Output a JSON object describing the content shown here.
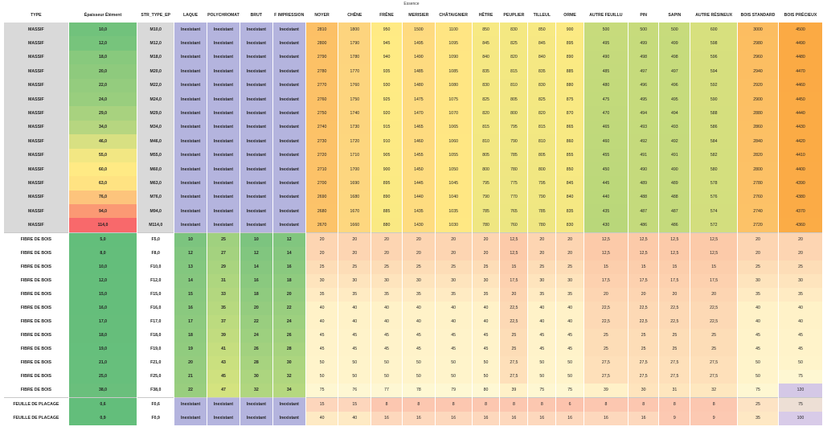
{
  "title": "Essence",
  "colors": {
    "type_massif": "#d9d9d9",
    "options_inexistant": "#b4b4de",
    "low": "#63be7b",
    "high": "#f8696b",
    "scale_low": "#ffeb84",
    "scale_high": "#f8a94a"
  },
  "headers": [
    "TYPE",
    "Épaisseur Élément",
    "STR_TYPE_EP",
    "LAQUE",
    "POLYCHROMAT",
    "BRUT",
    "F IMPRESSION",
    "NOYER",
    "CHÊNE",
    "FRÊNE",
    "MERISIER",
    "CHÂTAIGNIER",
    "HÊTRE",
    "PEUPLIER",
    "TILLEUL",
    "ORME",
    "AUTRE FEUILLU",
    "PIN",
    "SAPIN",
    "AUTRE RÉSINEUX",
    "BOIS STANDARD",
    "BOIS PRÉCIEUX"
  ],
  "rows": [
    {
      "group": "massif",
      "cells": [
        "MASSIF",
        "10,0",
        "M10,0",
        "Inexistant",
        "Inexistant",
        "Inexistant",
        "Inexistant",
        "2810",
        "1800",
        "950",
        "1500",
        "1100",
        "850",
        "830",
        "850",
        "900",
        "500",
        "500",
        "500",
        "600",
        "3000",
        "4500"
      ]
    },
    {
      "group": "massif",
      "cells": [
        "MASSIF",
        "12,0",
        "M12,0",
        "Inexistant",
        "Inexistant",
        "Inexistant",
        "Inexistant",
        "2800",
        "1790",
        "945",
        "1495",
        "1095",
        "845",
        "825",
        "845",
        "895",
        "495",
        "499",
        "499",
        "598",
        "2980",
        "4490"
      ]
    },
    {
      "group": "massif",
      "cells": [
        "MASSIF",
        "18,0",
        "M18,0",
        "Inexistant",
        "Inexistant",
        "Inexistant",
        "Inexistant",
        "2790",
        "1780",
        "940",
        "1490",
        "1090",
        "840",
        "820",
        "840",
        "890",
        "490",
        "498",
        "498",
        "596",
        "2960",
        "4480"
      ]
    },
    {
      "group": "massif",
      "cells": [
        "MASSIF",
        "20,0",
        "M20,0",
        "Inexistant",
        "Inexistant",
        "Inexistant",
        "Inexistant",
        "2780",
        "1770",
        "935",
        "1485",
        "1085",
        "835",
        "815",
        "835",
        "885",
        "485",
        "497",
        "497",
        "594",
        "2940",
        "4470"
      ]
    },
    {
      "group": "massif",
      "cells": [
        "MASSIF",
        "22,0",
        "M22,0",
        "Inexistant",
        "Inexistant",
        "Inexistant",
        "Inexistant",
        "2770",
        "1760",
        "930",
        "1480",
        "1080",
        "830",
        "810",
        "830",
        "880",
        "480",
        "496",
        "496",
        "592",
        "2920",
        "4460"
      ]
    },
    {
      "group": "massif",
      "cells": [
        "MASSIF",
        "24,0",
        "M24,0",
        "Inexistant",
        "Inexistant",
        "Inexistant",
        "Inexistant",
        "2760",
        "1750",
        "925",
        "1475",
        "1075",
        "825",
        "805",
        "825",
        "875",
        "475",
        "495",
        "495",
        "590",
        "2900",
        "4450"
      ]
    },
    {
      "group": "massif",
      "cells": [
        "MASSIF",
        "29,0",
        "M29,0",
        "Inexistant",
        "Inexistant",
        "Inexistant",
        "Inexistant",
        "2750",
        "1740",
        "920",
        "1470",
        "1070",
        "820",
        "800",
        "820",
        "870",
        "470",
        "494",
        "494",
        "588",
        "2880",
        "4440"
      ]
    },
    {
      "group": "massif",
      "cells": [
        "MASSIF",
        "34,0",
        "M34,0",
        "Inexistant",
        "Inexistant",
        "Inexistant",
        "Inexistant",
        "2740",
        "1730",
        "915",
        "1465",
        "1065",
        "815",
        "795",
        "815",
        "865",
        "465",
        "493",
        "493",
        "586",
        "2860",
        "4430"
      ]
    },
    {
      "group": "massif",
      "cells": [
        "MASSIF",
        "46,0",
        "M46,0",
        "Inexistant",
        "Inexistant",
        "Inexistant",
        "Inexistant",
        "2730",
        "1720",
        "910",
        "1460",
        "1060",
        "810",
        "790",
        "810",
        "860",
        "460",
        "492",
        "492",
        "584",
        "2840",
        "4420"
      ]
    },
    {
      "group": "massif",
      "cells": [
        "MASSIF",
        "55,0",
        "M55,0",
        "Inexistant",
        "Inexistant",
        "Inexistant",
        "Inexistant",
        "2720",
        "1710",
        "905",
        "1455",
        "1055",
        "805",
        "785",
        "805",
        "855",
        "455",
        "491",
        "491",
        "582",
        "2820",
        "4410"
      ]
    },
    {
      "group": "massif",
      "cells": [
        "MASSIF",
        "60,0",
        "M60,0",
        "Inexistant",
        "Inexistant",
        "Inexistant",
        "Inexistant",
        "2710",
        "1700",
        "900",
        "1450",
        "1050",
        "800",
        "780",
        "800",
        "850",
        "450",
        "490",
        "490",
        "580",
        "2800",
        "4400"
      ]
    },
    {
      "group": "massif",
      "cells": [
        "MASSIF",
        "63,0",
        "M63,0",
        "Inexistant",
        "Inexistant",
        "Inexistant",
        "Inexistant",
        "2700",
        "1690",
        "895",
        "1445",
        "1045",
        "795",
        "775",
        "795",
        "845",
        "445",
        "489",
        "489",
        "578",
        "2780",
        "4390"
      ]
    },
    {
      "group": "massif",
      "cells": [
        "MASSIF",
        "76,0",
        "M76,0",
        "Inexistant",
        "Inexistant",
        "Inexistant",
        "Inexistant",
        "2690",
        "1680",
        "890",
        "1440",
        "1040",
        "790",
        "770",
        "790",
        "840",
        "440",
        "488",
        "488",
        "576",
        "2760",
        "4380"
      ]
    },
    {
      "group": "massif",
      "cells": [
        "MASSIF",
        "94,0",
        "M94,0",
        "Inexistant",
        "Inexistant",
        "Inexistant",
        "Inexistant",
        "2680",
        "1670",
        "885",
        "1435",
        "1035",
        "785",
        "765",
        "785",
        "835",
        "435",
        "487",
        "487",
        "574",
        "2740",
        "4370"
      ]
    },
    {
      "group": "massif",
      "cells": [
        "MASSIF",
        "114,0",
        "M114,0",
        "Inexistant",
        "Inexistant",
        "Inexistant",
        "Inexistant",
        "2670",
        "1660",
        "880",
        "1430",
        "1030",
        "780",
        "760",
        "780",
        "830",
        "430",
        "486",
        "486",
        "572",
        "2720",
        "4360"
      ]
    },
    {
      "group": "fibre",
      "cells": [
        "FIBRE DE BOIS",
        "5,0",
        "F5,0",
        "10",
        "25",
        "10",
        "12",
        "20",
        "20",
        "20",
        "20",
        "20",
        "20",
        "12,5",
        "20",
        "20",
        "12,5",
        "12,5",
        "12,5",
        "12,5",
        "20",
        "20"
      ]
    },
    {
      "group": "fibre",
      "cells": [
        "FIBRE DE BOIS",
        "8,0",
        "F8,0",
        "12",
        "27",
        "12",
        "14",
        "20",
        "20",
        "20",
        "20",
        "20",
        "20",
        "12,5",
        "20",
        "20",
        "12,5",
        "12,5",
        "12,5",
        "12,5",
        "20",
        "20"
      ]
    },
    {
      "group": "fibre",
      "cells": [
        "FIBRE DE BOIS",
        "10,0",
        "F10,0",
        "13",
        "29",
        "14",
        "16",
        "25",
        "25",
        "25",
        "25",
        "25",
        "25",
        "15",
        "25",
        "25",
        "15",
        "15",
        "15",
        "15",
        "25",
        "25"
      ]
    },
    {
      "group": "fibre",
      "cells": [
        "FIBRE DE BOIS",
        "12,0",
        "F12,0",
        "14",
        "31",
        "16",
        "18",
        "30",
        "30",
        "30",
        "30",
        "30",
        "30",
        "17,5",
        "30",
        "30",
        "17,5",
        "17,5",
        "17,5",
        "17,5",
        "30",
        "30"
      ]
    },
    {
      "group": "fibre",
      "cells": [
        "FIBRE DE BOIS",
        "15,0",
        "F15,0",
        "15",
        "33",
        "18",
        "20",
        "35",
        "35",
        "35",
        "35",
        "35",
        "35",
        "20",
        "35",
        "35",
        "20",
        "20",
        "20",
        "20",
        "35",
        "35"
      ]
    },
    {
      "group": "fibre",
      "cells": [
        "FIBRE DE BOIS",
        "16,0",
        "F16,0",
        "16",
        "35",
        "20",
        "22",
        "40",
        "40",
        "40",
        "40",
        "40",
        "40",
        "22,5",
        "40",
        "40",
        "22,5",
        "22,5",
        "22,5",
        "22,5",
        "40",
        "40"
      ]
    },
    {
      "group": "fibre",
      "cells": [
        "FIBRE DE BOIS",
        "17,0",
        "F17,0",
        "17",
        "37",
        "22",
        "24",
        "40",
        "40",
        "40",
        "40",
        "40",
        "40",
        "22,5",
        "40",
        "40",
        "22,5",
        "22,5",
        "22,5",
        "22,5",
        "40",
        "40"
      ]
    },
    {
      "group": "fibre",
      "cells": [
        "FIBRE DE BOIS",
        "18,0",
        "F18,0",
        "18",
        "39",
        "24",
        "26",
        "45",
        "45",
        "45",
        "45",
        "45",
        "45",
        "25",
        "45",
        "45",
        "25",
        "25",
        "25",
        "25",
        "45",
        "45"
      ]
    },
    {
      "group": "fibre",
      "cells": [
        "FIBRE DE BOIS",
        "19,0",
        "F19,0",
        "19",
        "41",
        "26",
        "28",
        "45",
        "45",
        "45",
        "45",
        "45",
        "45",
        "25",
        "45",
        "45",
        "25",
        "25",
        "25",
        "25",
        "45",
        "45"
      ]
    },
    {
      "group": "fibre",
      "cells": [
        "FIBRE DE BOIS",
        "21,0",
        "F21,0",
        "20",
        "43",
        "28",
        "30",
        "50",
        "50",
        "50",
        "50",
        "50",
        "50",
        "27,5",
        "50",
        "50",
        "27,5",
        "27,5",
        "27,5",
        "27,5",
        "50",
        "50"
      ]
    },
    {
      "group": "fibre",
      "cells": [
        "FIBRE DE BOIS",
        "25,0",
        "F25,0",
        "21",
        "45",
        "30",
        "32",
        "50",
        "50",
        "50",
        "50",
        "50",
        "50",
        "27,5",
        "50",
        "50",
        "27,5",
        "27,5",
        "27,5",
        "27,5",
        "50",
        "75"
      ]
    },
    {
      "group": "fibre",
      "cells": [
        "FIBRE DE BOIS",
        "38,0",
        "F38,0",
        "22",
        "47",
        "32",
        "34",
        "75",
        "76",
        "77",
        "78",
        "79",
        "80",
        "39",
        "75",
        "75",
        "39",
        "30",
        "31",
        "32",
        "75",
        "120"
      ]
    },
    {
      "group": "feuille",
      "cells": [
        "FEUILLE DE PLACAGE",
        "0,6",
        "F0,6",
        "Inexistant",
        "Inexistant",
        "Inexistant",
        "Inexistant",
        "15",
        "15",
        "8",
        "8",
        "8",
        "8",
        "8",
        "8",
        "6",
        "8",
        "8",
        "8",
        "8",
        "25",
        "75"
      ]
    },
    {
      "group": "feuille",
      "cells": [
        "FEUILLE DE PLACAGE",
        "0,9",
        "F0,9",
        "Inexistant",
        "Inexistant",
        "Inexistant",
        "Inexistant",
        "40",
        "40",
        "16",
        "16",
        "16",
        "16",
        "16",
        "16",
        "16",
        "16",
        "16",
        "9",
        "9",
        "35",
        "100"
      ]
    }
  ]
}
